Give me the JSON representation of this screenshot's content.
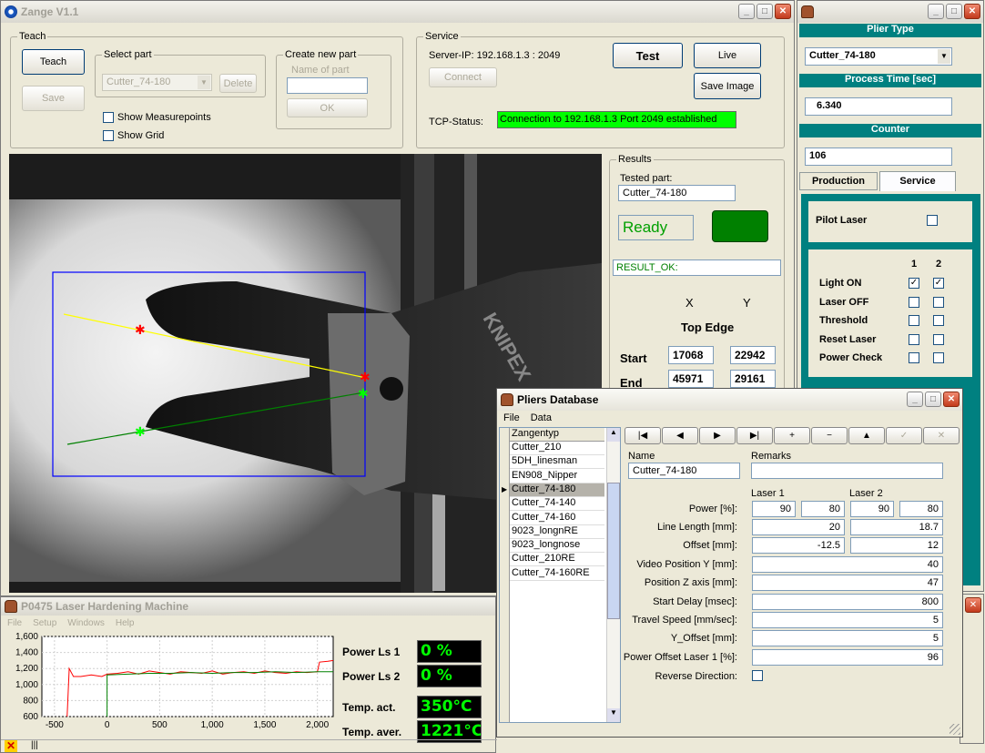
{
  "main_window": {
    "title": "Zange  V1.1",
    "teach": {
      "group": "Teach",
      "teach_btn": "Teach",
      "save_btn": "Save",
      "select_part_label": "Select part",
      "select_value": "Cutter_74-180",
      "delete_btn": "Delete",
      "show_measurepoints": "Show Measurepoints",
      "show_grid": "Show Grid",
      "create_group": "Create new part",
      "name_of_part": "Name of part",
      "ok_btn": "OK"
    },
    "service": {
      "group": "Service",
      "server_ip": "Server-IP:  192.168.1.3  :  2049",
      "connect_btn": "Connect",
      "test_btn": "Test",
      "live_btn": "Live",
      "save_image_btn": "Save Image",
      "tcp_label": "TCP-Status:",
      "tcp_status": "Connection to 192.168.1.3  Port 2049 established"
    },
    "results": {
      "group": "Results",
      "tested_part_label": "Tested part:",
      "tested_part": "Cutter_74-180",
      "ready": "Ready",
      "result_text": "RESULT_OK:",
      "x_header": "X",
      "y_header": "Y",
      "top_edge": "Top Edge",
      "start_label": "Start",
      "end_label": "End",
      "start_x": "17068",
      "start_y": "22942",
      "end_x": "45971",
      "end_y": "29161"
    },
    "colors": {
      "ready_green": "#00a000",
      "status_green": "#00ff00",
      "result_led": "#008000"
    }
  },
  "right_panel": {
    "plier_type_header": "Plier Type",
    "plier_type_value": "Cutter_74-180",
    "process_time_header": "Process Time [sec]",
    "process_time_value": "6.340",
    "counter_header": "Counter",
    "counter_value": "106",
    "tab_production": "Production",
    "tab_service": "Service",
    "pilot_laser": "Pilot Laser",
    "col1": "1",
    "col2": "2",
    "rows": [
      {
        "label": "Light ON",
        "c1": true,
        "c2": true
      },
      {
        "label": "Laser OFF",
        "c1": false,
        "c2": false
      },
      {
        "label": "Threshold",
        "c1": false,
        "c2": false
      },
      {
        "label": "Reset Laser",
        "c1": false,
        "c2": false
      },
      {
        "label": "Power Check",
        "c1": false,
        "c2": false
      }
    ],
    "colors": {
      "teal": "#008080"
    }
  },
  "machine_window": {
    "title": "P0475 Laser Hardening Machine",
    "menu": [
      "File",
      "Setup",
      "Windows",
      "Help"
    ],
    "readouts": [
      {
        "label": "Power Ls 1",
        "value": "0 %"
      },
      {
        "label": "Power Ls 2",
        "value": "0 %"
      },
      {
        "label": "Temp. act.",
        "value": "350°C"
      },
      {
        "label": "Temp. aver.",
        "value": "1221°C"
      }
    ]
  },
  "chart_data": {
    "type": "line",
    "xlim": [
      -620,
      2150
    ],
    "ylim": [
      600,
      1600
    ],
    "x_ticks": [
      "-500",
      "0",
      "500",
      "1,000",
      "1,500",
      "2,000"
    ],
    "y_ticks": [
      "1,600",
      "1,400",
      "1,200",
      "1,000",
      "800",
      "600"
    ],
    "grid": true,
    "series": [
      {
        "color": "#ff0000",
        "x": [
          -380,
          -360,
          -320,
          -250,
          -150,
          -50,
          0,
          100,
          200,
          300,
          400,
          500,
          600,
          700,
          800,
          900,
          1000,
          1100,
          1200,
          1300,
          1400,
          1500,
          1600,
          1700,
          1800,
          1900,
          2000,
          2020,
          2100,
          2150
        ],
        "y": [
          600,
          1200,
          1100,
          1100,
          1120,
          1100,
          1130,
          1140,
          1160,
          1130,
          1170,
          1150,
          1130,
          1160,
          1150,
          1140,
          1170,
          1130,
          1150,
          1160,
          1140,
          1170,
          1150,
          1140,
          1160,
          1150,
          1160,
          1280,
          1290,
          1300
        ]
      },
      {
        "color": "#008000",
        "x": [
          0,
          0,
          200,
          400,
          600,
          800,
          1000,
          1200,
          1400,
          1600,
          1800,
          2000,
          2150
        ],
        "y": [
          600,
          1120,
          1130,
          1140,
          1140,
          1150,
          1140,
          1150,
          1150,
          1160,
          1150,
          1160,
          1160
        ]
      }
    ]
  },
  "pliers_db": {
    "title": "Pliers Database",
    "menu": [
      "File",
      "Data"
    ],
    "list_header": "Zangentyp",
    "list": [
      "Cutter_210",
      "5DH_linesman",
      "EN908_Nipper",
      "Cutter_74-180",
      "Cutter_74-140",
      "Cutter_74-160",
      "9023_longnRE",
      "9023_longnose",
      "Cutter_210RE",
      "Cutter_74-160RE"
    ],
    "selected": "Cutter_74-180",
    "nav": [
      "|◀",
      "◀",
      "▶",
      "▶|",
      "+",
      "−",
      "▲",
      "✓",
      "✕"
    ],
    "name_label": "Name",
    "name_value": "Cutter_74-180",
    "remarks_label": "Remarks",
    "remarks_value": "",
    "laser1": "Laser 1",
    "laser2": "Laser 2",
    "power_label": "Power [%]:",
    "power": [
      "90",
      "80",
      "90",
      "80"
    ],
    "line_length_label": "Line Length [mm]:",
    "line_length": [
      "20",
      "18.7"
    ],
    "offset_label": "Offset [mm]:",
    "offset": [
      "-12.5",
      "12"
    ],
    "fields": [
      {
        "label": "Video Position Y [mm]:",
        "value": "40"
      },
      {
        "label": "Position Z axis [mm]:",
        "value": "47"
      },
      {
        "label": "Start Delay [msec]:",
        "value": "800"
      },
      {
        "label": "Travel Speed [mm/sec]:",
        "value": "5"
      },
      {
        "label": "Y_Offset [mm]:",
        "value": "5"
      },
      {
        "label": "Power Offset Laser 1 [%]:",
        "value": "96"
      }
    ],
    "reverse_label": "Reverse Direction:"
  }
}
